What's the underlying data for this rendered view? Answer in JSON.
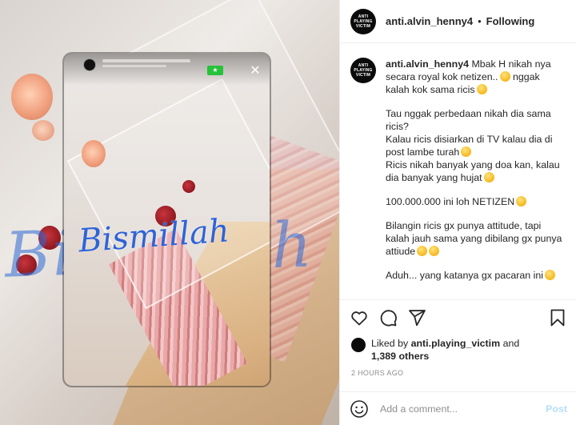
{
  "post": {
    "author": "anti.alvin_henny4",
    "follow_status": "Following",
    "separator": "•",
    "avatar_text": "ANTI PLAYING VICTIM"
  },
  "media": {
    "script_text": "Bismillah",
    "story_badge": "★",
    "close_glyph": "✕"
  },
  "caption": {
    "author": "anti.alvin_henny4",
    "p1": "Mbak H nikah nya secara royal kok netizen..",
    "p1b": " nggak kalah kok sama ricis",
    "p2": "Tau nggak perbedaan nikah dia sama ricis?",
    "p3": "Kalau ricis disiarkan di TV kalau dia di post lambe turah",
    "p4": "Ricis nikah banyak yang doa kan, kalau dia banyak yang hujat",
    "p5": "100.000.000 ini loh NETIZEN",
    "p6": "Bilangin ricis gx punya attitude, tapi kalah jauh sama yang dibilang gx punya attiude",
    "p7": "Aduh... yang katanya gx pacaran ini"
  },
  "actions": {
    "like": "heart-icon",
    "comment": "comment-icon",
    "share": "share-icon",
    "save": "bookmark-icon"
  },
  "likes": {
    "prefix": "Liked by ",
    "user": "anti.playing_victim",
    "middle": " and",
    "others": "1,389 others"
  },
  "timestamp": "2 HOURS AGO",
  "comment_box": {
    "placeholder": "Add a comment...",
    "post_label": "Post"
  },
  "colors": {
    "text": "#262626",
    "muted": "#8e8e8e",
    "post_disabled": "#b2dffc",
    "script_blue": "#2e63d8"
  }
}
